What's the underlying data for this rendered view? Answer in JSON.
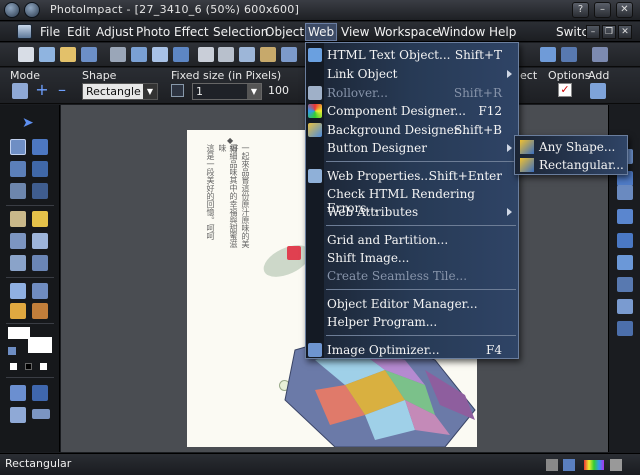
{
  "window": {
    "title": "PhotoImpact - [27_3410_6 (50%) 600x600]"
  },
  "menubar": {
    "items": [
      "File",
      "Edit",
      "Adjust",
      "Photo",
      "Effect",
      "Selection",
      "Object",
      "Web",
      "View",
      "Workspace",
      "Window",
      "Help"
    ],
    "active": "Web",
    "switch_label": "Switcl"
  },
  "attribute_bar": {
    "mode_label": "Mode",
    "shape_label": "Shape",
    "shape_value": "Rectangle",
    "fixed_size_label": "Fixed size (in Pixels)",
    "size_value_1": "1",
    "size_value_2": "100",
    "object_label": "ect",
    "options_label": "Options",
    "add_label": "Add"
  },
  "web_menu": {
    "items": [
      {
        "label": "HTML Text Object...",
        "shortcut": "Shift+T",
        "icon": "html-text-icon",
        "disabled": false
      },
      {
        "label": "Link Object",
        "shortcut": "",
        "icon": "",
        "disabled": false,
        "submenu": true
      },
      {
        "label": "Rollover...",
        "shortcut": "Shift+R",
        "icon": "rollover-icon",
        "disabled": true
      },
      {
        "label": "Component Designer...",
        "shortcut": "F12",
        "icon": "component-icon",
        "disabled": false
      },
      {
        "label": "Background Designer...",
        "shortcut": "Shift+B",
        "icon": "background-icon",
        "disabled": false
      },
      {
        "label": "Button Designer",
        "shortcut": "",
        "icon": "",
        "disabled": false,
        "submenu": true,
        "highlighted": true
      },
      {
        "label": "Web Properties...",
        "shortcut": "Shift+Enter",
        "icon": "web-properties-icon",
        "disabled": false
      },
      {
        "label": "Check HTML Rendering Errors...",
        "shortcut": "",
        "icon": "",
        "disabled": false
      },
      {
        "label": "Web Attributes",
        "shortcut": "",
        "icon": "",
        "disabled": false,
        "submenu": true
      },
      {
        "label": "Grid and Partition...",
        "shortcut": "",
        "icon": "",
        "disabled": false
      },
      {
        "label": "Shift Image...",
        "shortcut": "",
        "icon": "",
        "disabled": false
      },
      {
        "label": "Create Seamless Tile...",
        "shortcut": "",
        "icon": "",
        "disabled": true
      },
      {
        "label": "Object Editor Manager...",
        "shortcut": "",
        "icon": "",
        "disabled": false
      },
      {
        "label": "Helper Program...",
        "shortcut": "",
        "icon": "",
        "disabled": false
      },
      {
        "label": "Image Optimizer...",
        "shortcut": "F4",
        "icon": "image-optimizer-icon",
        "disabled": false
      }
    ]
  },
  "button_designer_submenu": {
    "items": [
      {
        "label": "Any Shape...",
        "icon": "any-shape-icon"
      },
      {
        "label": "Rectangular...",
        "icon": "rectangular-icon"
      }
    ]
  },
  "canvas": {
    "text_col_1": "一起來品嘗這份原汁原味的美好",
    "text_col_2": "細細品味其中的幸福與甜蜜滋味",
    "text_col_3": "這是一段美好的回憶。呵呵",
    "footer": "—— 紫羽 ——"
  },
  "status": {
    "text": "Rectangular"
  },
  "colors": {
    "menu_bg": "#273a55",
    "highlight": "#3a5b86",
    "workspace": "#4a4d52"
  }
}
